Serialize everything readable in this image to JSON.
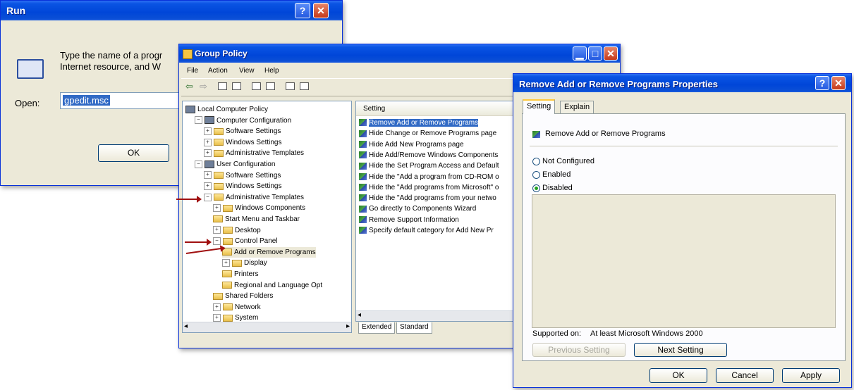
{
  "run": {
    "title": "Run",
    "description_line1": "Type the name of a progr",
    "description_line2": "Internet resource, and W",
    "open_label": "Open:",
    "open_value": "gpedit.msc",
    "ok_label": "OK"
  },
  "group_policy": {
    "title": "Group Policy",
    "menu": [
      "File",
      "Action",
      "View",
      "Help"
    ],
    "tree": [
      {
        "label": "Local Computer Policy",
        "indent": 0,
        "exp": "",
        "icon": "pc"
      },
      {
        "label": "Computer Configuration",
        "indent": 1,
        "exp": "−",
        "icon": "pc"
      },
      {
        "label": "Software Settings",
        "indent": 2,
        "exp": "+",
        "icon": "folder"
      },
      {
        "label": "Windows Settings",
        "indent": 2,
        "exp": "+",
        "icon": "folder"
      },
      {
        "label": "Administrative Templates",
        "indent": 2,
        "exp": "+",
        "icon": "folder"
      },
      {
        "label": "User Configuration",
        "indent": 1,
        "exp": "−",
        "icon": "pc"
      },
      {
        "label": "Software Settings",
        "indent": 2,
        "exp": "+",
        "icon": "folder"
      },
      {
        "label": "Windows Settings",
        "indent": 2,
        "exp": "+",
        "icon": "folder"
      },
      {
        "label": "Administrative Templates",
        "indent": 2,
        "exp": "−",
        "icon": "folder"
      },
      {
        "label": "Windows Components",
        "indent": 3,
        "exp": "+",
        "icon": "folder"
      },
      {
        "label": "Start Menu and Taskbar",
        "indent": 3,
        "exp": "",
        "icon": "folder"
      },
      {
        "label": "Desktop",
        "indent": 3,
        "exp": "+",
        "icon": "folder"
      },
      {
        "label": "Control Panel",
        "indent": 3,
        "exp": "−",
        "icon": "folder"
      },
      {
        "label": "Add or Remove Programs",
        "indent": 4,
        "exp": "",
        "icon": "folder",
        "selected": true
      },
      {
        "label": "Display",
        "indent": 4,
        "exp": "+",
        "icon": "folder"
      },
      {
        "label": "Printers",
        "indent": 4,
        "exp": "",
        "icon": "folder"
      },
      {
        "label": "Regional and Language Opt",
        "indent": 4,
        "exp": "",
        "icon": "folder"
      },
      {
        "label": "Shared Folders",
        "indent": 3,
        "exp": "",
        "icon": "folder"
      },
      {
        "label": "Network",
        "indent": 3,
        "exp": "+",
        "icon": "folder"
      },
      {
        "label": "System",
        "indent": 3,
        "exp": "+",
        "icon": "folder"
      }
    ],
    "list_header": "Setting",
    "settings": [
      {
        "label": "Remove Add or Remove Programs",
        "selected": true
      },
      {
        "label": "Hide Change or Remove Programs page"
      },
      {
        "label": "Hide Add New Programs page"
      },
      {
        "label": "Hide Add/Remove Windows Components"
      },
      {
        "label": "Hide the Set Program Access and Default"
      },
      {
        "label": "Hide the \"Add a program from CD-ROM o"
      },
      {
        "label": "Hide the \"Add programs from Microsoft\" o"
      },
      {
        "label": "Hide the \"Add programs from your netwo"
      },
      {
        "label": "Go directly to Components Wizard"
      },
      {
        "label": "Remove Support Information"
      },
      {
        "label": "Specify default category for Add New Pr"
      }
    ],
    "tab_extended": "Extended",
    "tab_standard": "Standard"
  },
  "properties": {
    "title": "Remove Add or Remove Programs Properties",
    "tab_setting": "Setting",
    "tab_explain": "Explain",
    "policy_name": "Remove Add or Remove Programs",
    "options": [
      {
        "label": "Not Configured",
        "checked": false
      },
      {
        "label": "Enabled",
        "checked": false
      },
      {
        "label": "Disabled",
        "checked": true
      }
    ],
    "supported_label": "Supported on:",
    "supported_value": "At least Microsoft Windows 2000",
    "prev_label": "Previous Setting",
    "next_label": "Next Setting",
    "ok_label": "OK",
    "cancel_label": "Cancel",
    "apply_label": "Apply"
  }
}
